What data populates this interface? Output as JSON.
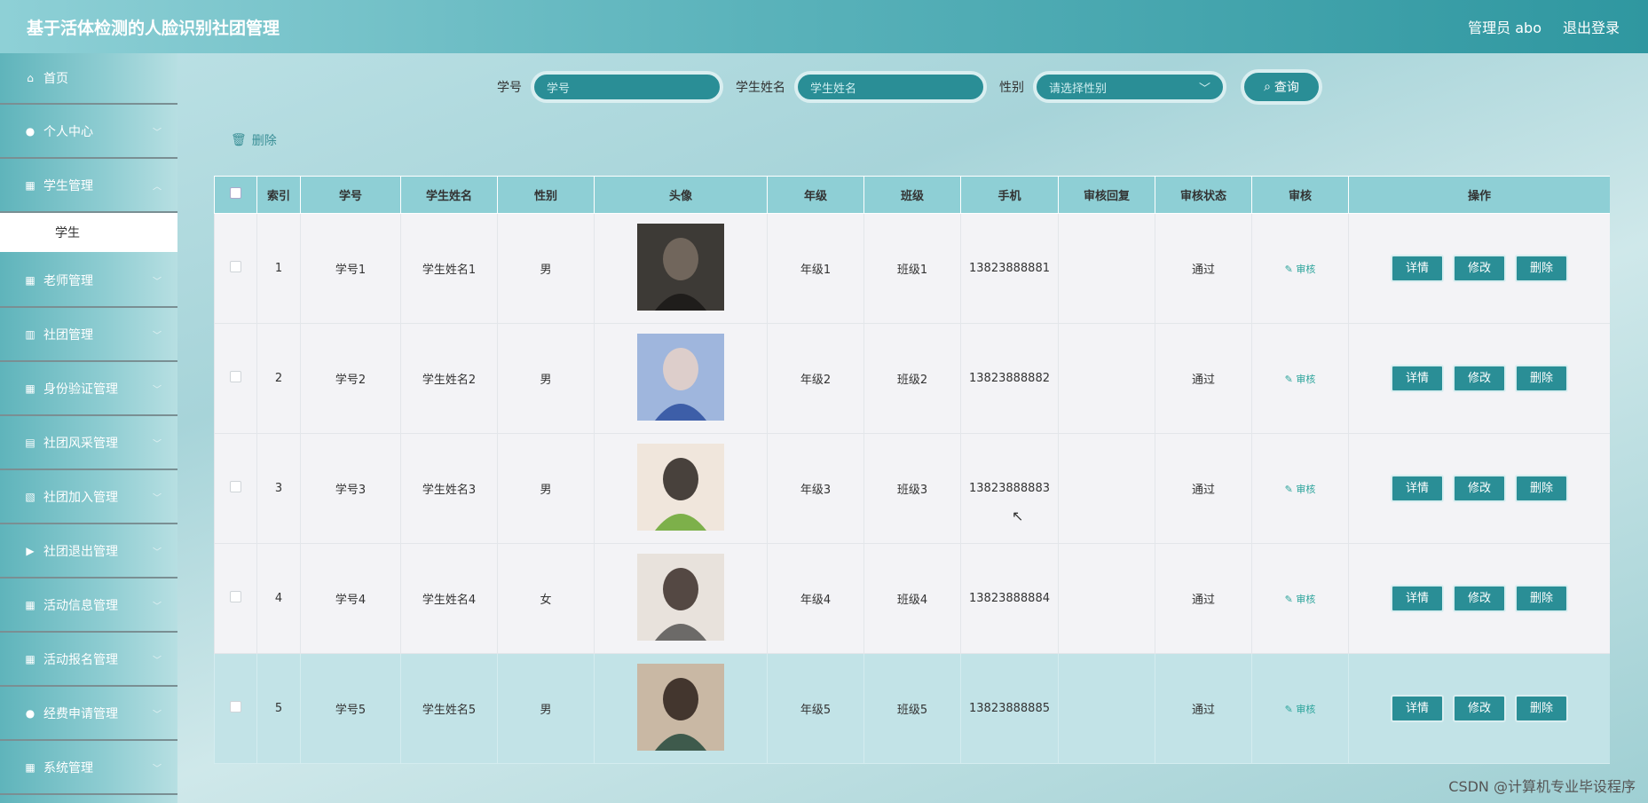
{
  "header": {
    "title": "基于活体检测的人脸识别社团管理",
    "user": "管理员 abo",
    "logout": "退出登录"
  },
  "sidebar": {
    "items": [
      {
        "label": "首页",
        "icon": "home-icon",
        "has_children": false
      },
      {
        "label": "个人中心",
        "icon": "user-icon",
        "has_children": true
      },
      {
        "label": "学生管理",
        "icon": "grid-icon",
        "has_children": true,
        "expanded": true,
        "children": [
          {
            "label": "学生"
          }
        ]
      },
      {
        "label": "老师管理",
        "icon": "grid-icon",
        "has_children": true
      },
      {
        "label": "社团管理",
        "icon": "bars-icon",
        "has_children": true
      },
      {
        "label": "身份验证管理",
        "icon": "grid-icon",
        "has_children": true
      },
      {
        "label": "社团风采管理",
        "icon": "clipboard-icon",
        "has_children": true
      },
      {
        "label": "社团加入管理",
        "icon": "chart-icon",
        "has_children": true
      },
      {
        "label": "社团退出管理",
        "icon": "video-icon",
        "has_children": true
      },
      {
        "label": "活动信息管理",
        "icon": "grid-icon",
        "has_children": true
      },
      {
        "label": "活动报名管理",
        "icon": "grid-icon",
        "has_children": true
      },
      {
        "label": "经费申请管理",
        "icon": "user-icon",
        "has_children": true
      },
      {
        "label": "系统管理",
        "icon": "grid-icon",
        "has_children": true
      }
    ]
  },
  "search": {
    "id_label": "学号",
    "id_placeholder": "学号",
    "name_label": "学生姓名",
    "name_placeholder": "学生姓名",
    "gender_label": "性别",
    "gender_placeholder": "请选择性别",
    "query_label": "查询"
  },
  "toolbar": {
    "delete_label": "删除"
  },
  "table": {
    "columns": [
      "索引",
      "学号",
      "学生姓名",
      "性别",
      "头像",
      "年级",
      "班级",
      "手机",
      "审核回复",
      "审核状态",
      "审核",
      "操作"
    ],
    "audit_label": "审核",
    "actions": {
      "detail": "详情",
      "edit": "修改",
      "delete": "删除"
    },
    "rows": [
      {
        "index": "1",
        "id": "学号1",
        "name": "学生姓名1",
        "gender": "男",
        "grade": "年级1",
        "class": "班级1",
        "phone": "13823888881",
        "reply": "",
        "status": "通过"
      },
      {
        "index": "2",
        "id": "学号2",
        "name": "学生姓名2",
        "gender": "男",
        "grade": "年级2",
        "class": "班级2",
        "phone": "13823888882",
        "reply": "",
        "status": "通过"
      },
      {
        "index": "3",
        "id": "学号3",
        "name": "学生姓名3",
        "gender": "男",
        "grade": "年级3",
        "class": "班级3",
        "phone": "13823888883",
        "reply": "",
        "status": "通过"
      },
      {
        "index": "4",
        "id": "学号4",
        "name": "学生姓名4",
        "gender": "女",
        "grade": "年级4",
        "class": "班级4",
        "phone": "13823888884",
        "reply": "",
        "status": "通过"
      },
      {
        "index": "5",
        "id": "学号5",
        "name": "学生姓名5",
        "gender": "男",
        "grade": "年级5",
        "class": "班级5",
        "phone": "13823888885",
        "reply": "",
        "status": "通过"
      }
    ]
  },
  "watermark": "CSDN @计算机专业毕设程序",
  "colors": {
    "accent": "#2a8e96",
    "header_th": "#8ecfd5",
    "row_highlight": "#c2e3e7"
  }
}
